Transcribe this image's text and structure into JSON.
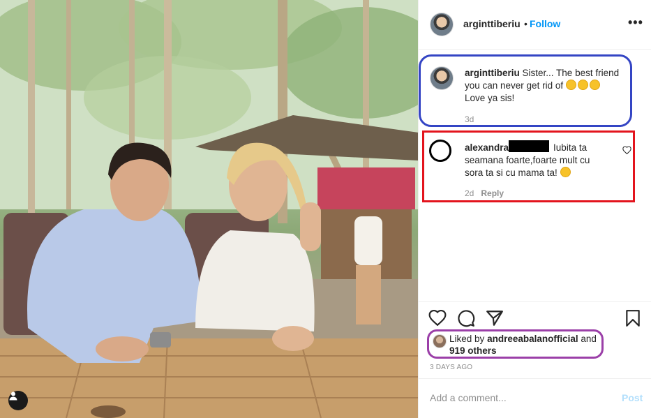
{
  "header": {
    "username": "arginttiberiu",
    "separator": "•",
    "follow_label": "Follow",
    "more_label": "•••"
  },
  "caption": {
    "username": "arginttiberiu",
    "text": "Sister... The best friend you can never get rid of",
    "emojis": [
      "face-with-tongue-emoji",
      "rolling-on-floor-laughing-emoji",
      "face-blowing-kiss-emoji"
    ],
    "text2": "Love ya sis!",
    "age": "3d"
  },
  "comment": {
    "username": "alexandra",
    "text_line1": "Iubita ta",
    "text_line2": "seamana foarte,foarte mult cu",
    "text_line3": "sora ta si cu mama ta!",
    "emoji": "smiling-face-emoji",
    "age": "2d",
    "reply_label": "Reply"
  },
  "likes": {
    "prefix": "Liked by",
    "user": "andreeabalanofficial",
    "joiner": "and",
    "others": "919 others"
  },
  "post_time": "3 DAYS AGO",
  "add_comment": {
    "placeholder": "Add a comment...",
    "post_label": "Post"
  },
  "colors": {
    "accent": "#0095f6",
    "post_disabled": "#b2dffc",
    "annotation_blue": "#3445c4",
    "annotation_red": "#e3141d",
    "annotation_purple": "#9b3fa8"
  }
}
